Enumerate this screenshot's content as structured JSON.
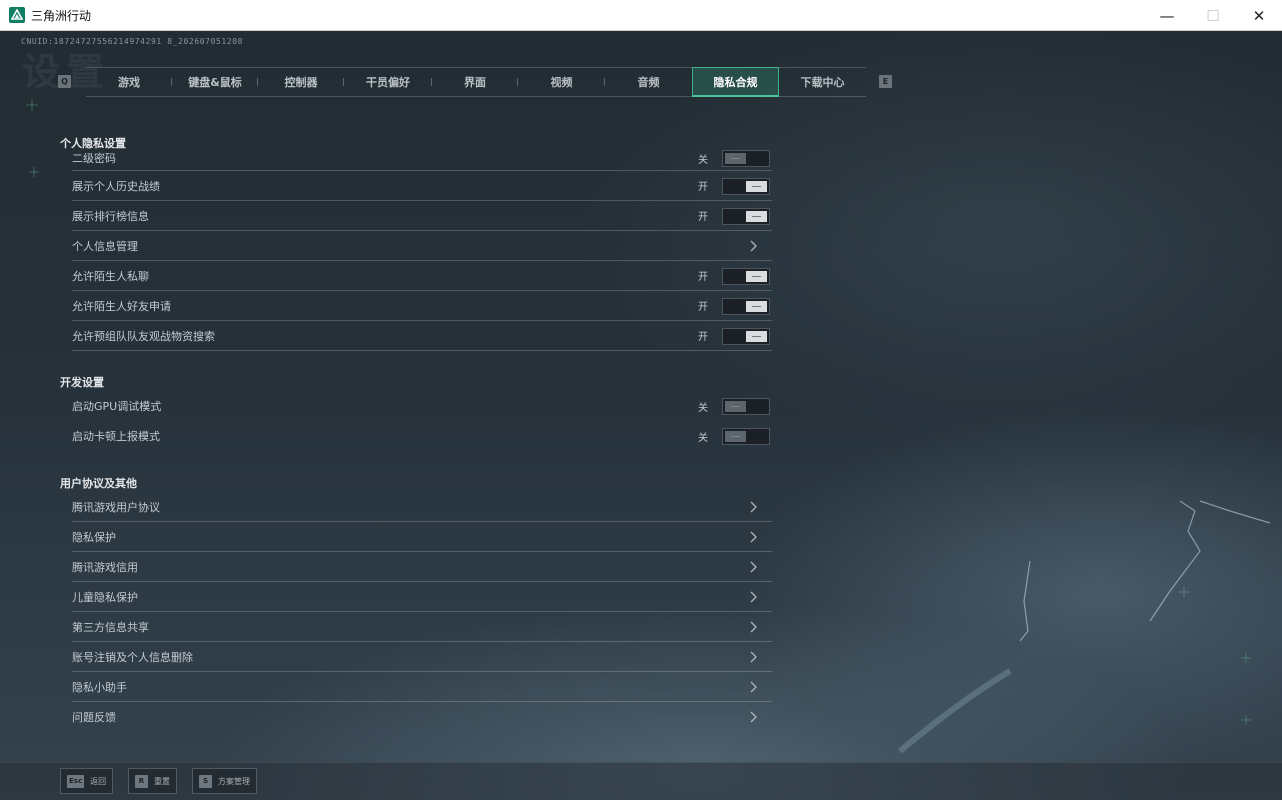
{
  "window": {
    "title": "三角洲行动",
    "minimize": "—",
    "maximize": "☐",
    "close": "✕"
  },
  "cnuid": "CNUID:18724727556214974291 8_202607051208",
  "bg_title": "设置",
  "tab_hints": {
    "prev": "Q",
    "next": "E"
  },
  "tabs": [
    {
      "label": "游戏",
      "active": false
    },
    {
      "label": "键盘&鼠标",
      "active": false
    },
    {
      "label": "控制器",
      "active": false
    },
    {
      "label": "干员偏好",
      "active": false
    },
    {
      "label": "界面",
      "active": false
    },
    {
      "label": "视频",
      "active": false
    },
    {
      "label": "音频",
      "active": false
    },
    {
      "label": "隐私合规",
      "active": true
    },
    {
      "label": "下载中心",
      "active": false
    }
  ],
  "sections": {
    "privacy": {
      "title": "个人隐私设置",
      "items": [
        {
          "label": "二级密码",
          "state": "关",
          "kind": "toggle",
          "on": false
        },
        {
          "label": "展示个人历史战绩",
          "state": "开",
          "kind": "toggle",
          "on": true
        },
        {
          "label": "展示排行榜信息",
          "state": "开",
          "kind": "toggle",
          "on": true
        },
        {
          "label": "个人信息管理",
          "state": "",
          "kind": "link"
        },
        {
          "label": "允许陌生人私聊",
          "state": "开",
          "kind": "toggle",
          "on": true
        },
        {
          "label": "允许陌生人好友申请",
          "state": "开",
          "kind": "toggle",
          "on": true
        },
        {
          "label": "允许预组队队友观战物资搜索",
          "state": "开",
          "kind": "toggle",
          "on": true
        }
      ]
    },
    "dev": {
      "title": "开发设置",
      "items": [
        {
          "label": "启动GPU调试模式",
          "state": "关",
          "kind": "toggle",
          "on": false
        },
        {
          "label": "启动卡顿上报模式",
          "state": "关",
          "kind": "toggle",
          "on": false
        }
      ]
    },
    "agreements": {
      "title": "用户协议及其他",
      "items": [
        {
          "label": "腾讯游戏用户协议",
          "kind": "link"
        },
        {
          "label": "隐私保护",
          "kind": "link"
        },
        {
          "label": "腾讯游戏信用",
          "kind": "link"
        },
        {
          "label": "儿童隐私保护",
          "kind": "link"
        },
        {
          "label": "第三方信息共享",
          "kind": "link"
        },
        {
          "label": "账号注销及个人信息删除",
          "kind": "link"
        },
        {
          "label": "隐私小助手",
          "kind": "link"
        },
        {
          "label": "问题反馈",
          "kind": "link"
        }
      ]
    }
  },
  "bottom_bar": [
    {
      "key": "Esc",
      "label": "返回"
    },
    {
      "key": "R",
      "label": "重置"
    },
    {
      "key": "S",
      "label": "方案管理"
    }
  ],
  "colors": {
    "accent": "#3fb08a",
    "background": "#222c33"
  }
}
